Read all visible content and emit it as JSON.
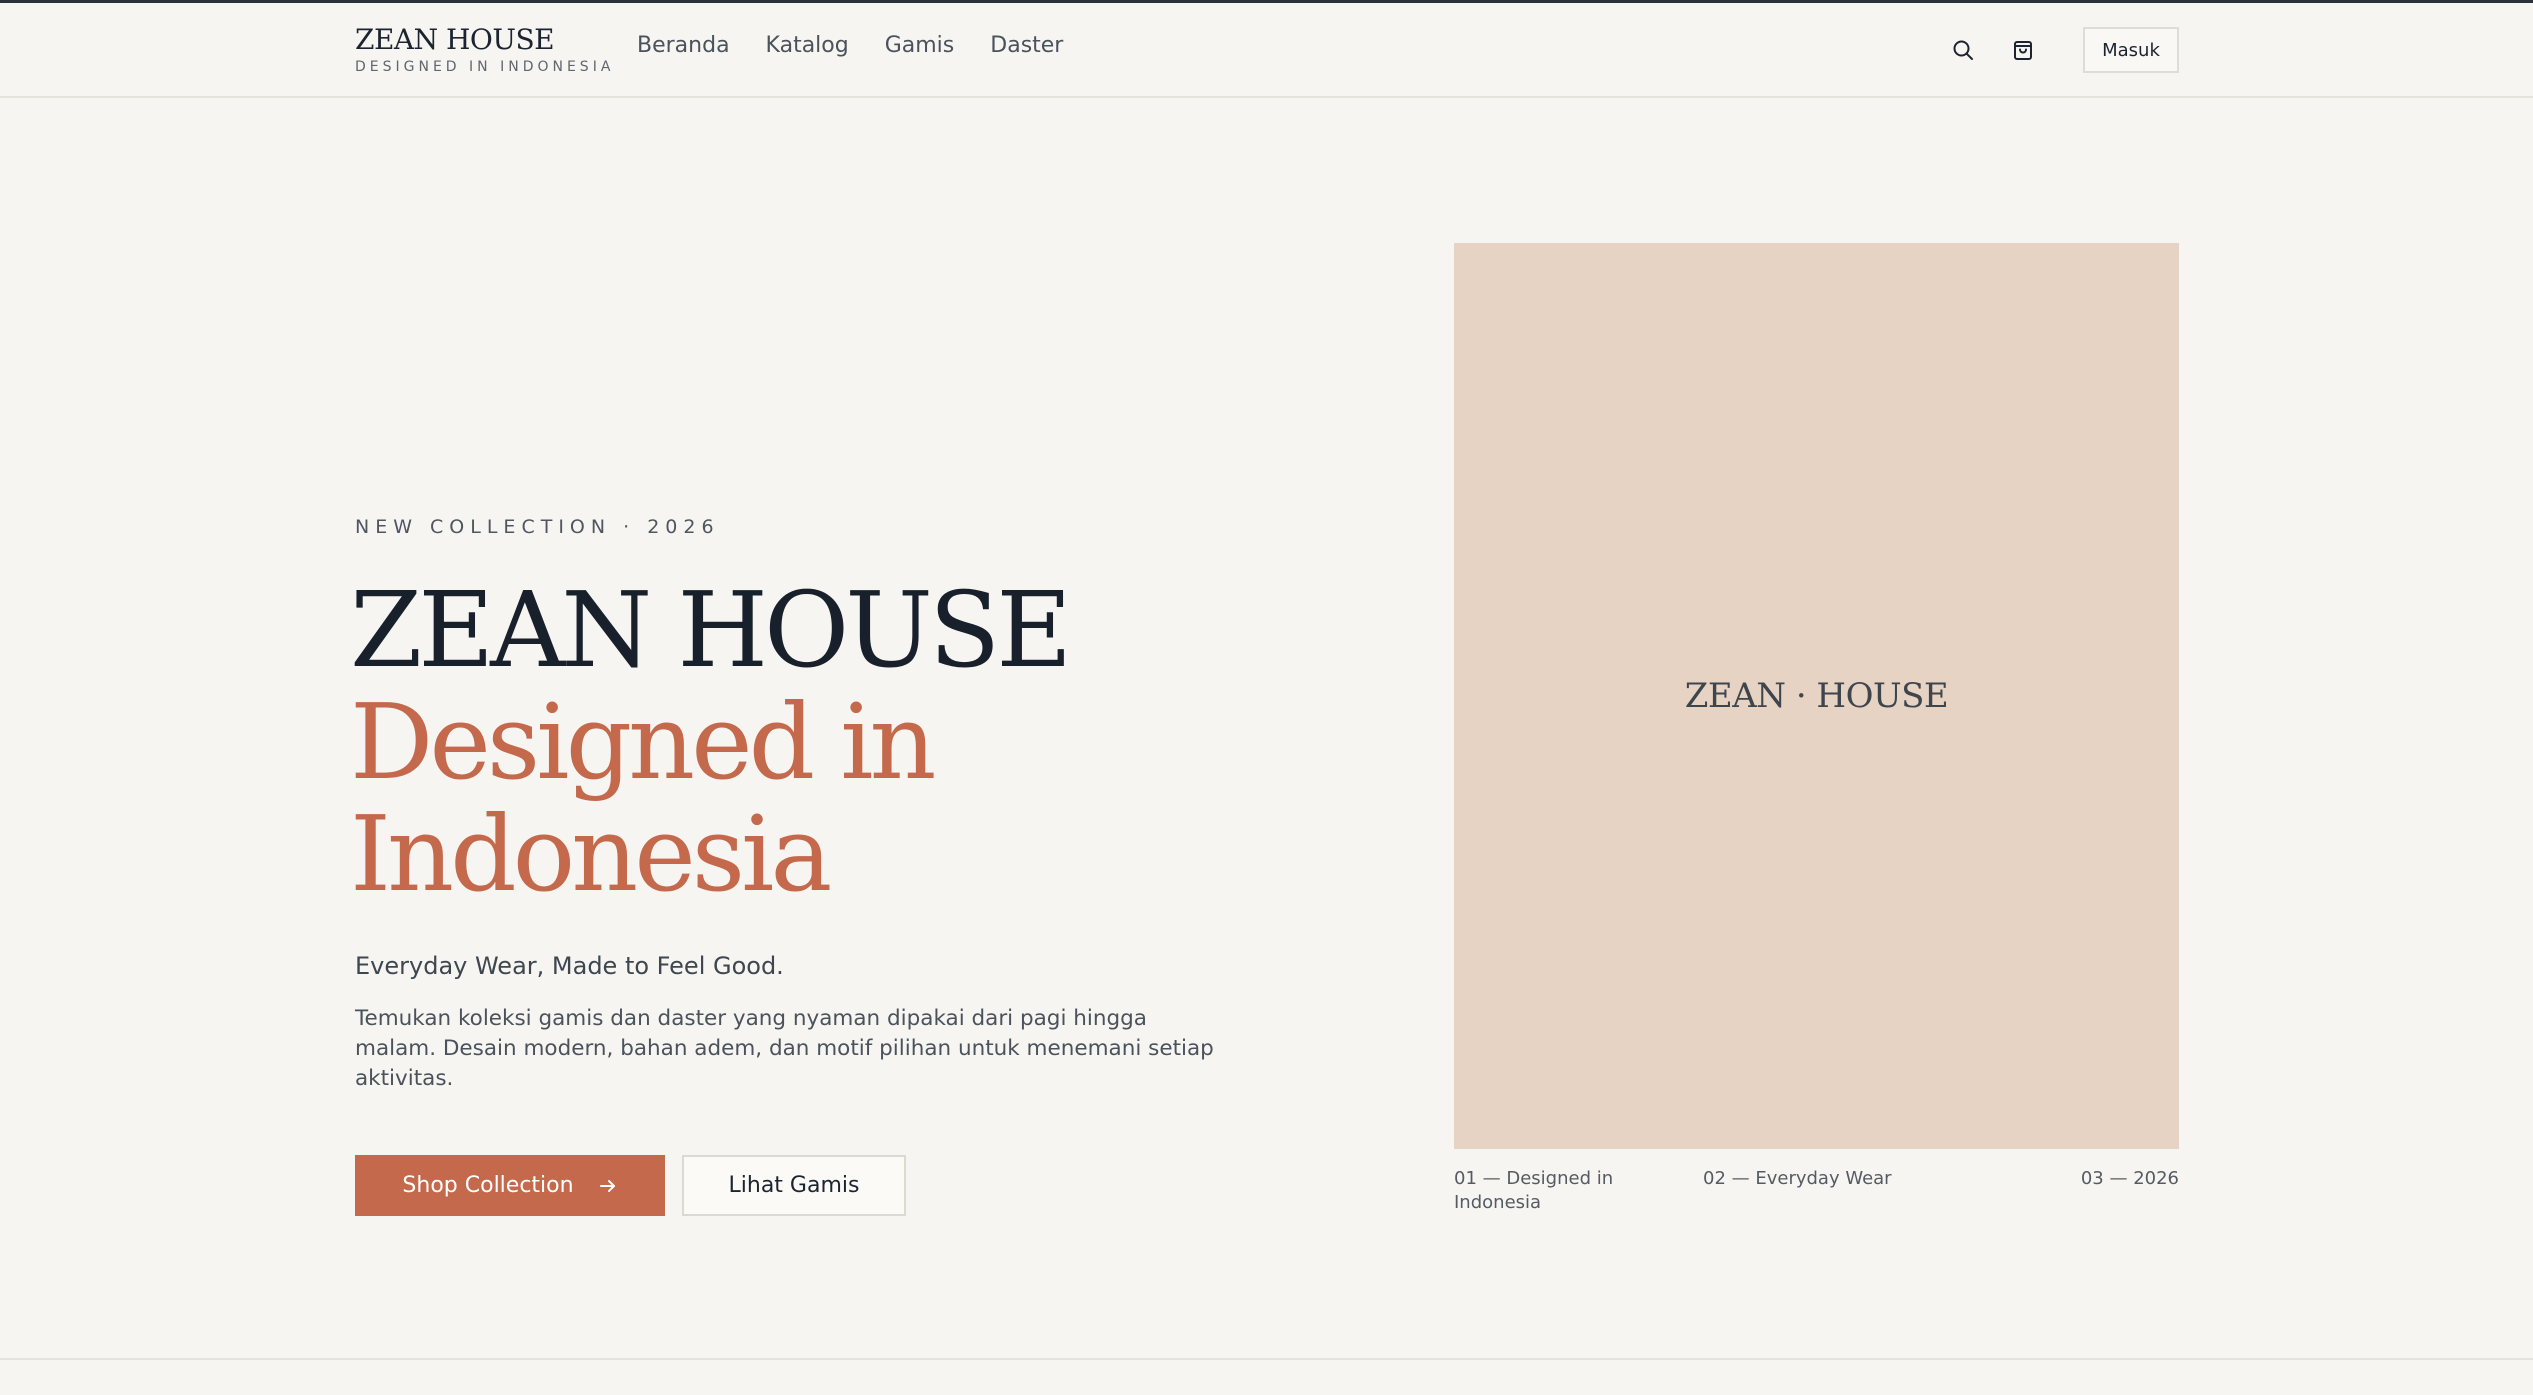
{
  "header": {
    "brand_name": "ZEAN HOUSE",
    "brand_tagline": "DESIGNED IN INDONESIA",
    "nav": [
      "Beranda",
      "Katalog",
      "Gamis",
      "Daster"
    ],
    "search_icon": "search-icon",
    "cart_icon": "shopping-bag-icon",
    "login_label": "Masuk"
  },
  "hero": {
    "eyebrow": "NEW COLLECTION · 2026",
    "title_line1": "ZEAN HOUSE",
    "title_line2": "Designed in",
    "title_line3": "Indonesia",
    "subtitle": "Everyday Wear, Made to Feel Good.",
    "description": "Temukan koleksi gamis dan daster yang nyaman dipakai dari pagi hingga malam. Desain modern, bahan adem, dan motif pilihan untuk menemani setiap aktivitas.",
    "primary_button": "Shop Collection",
    "primary_button_icon": "arrow-right-icon",
    "secondary_button": "Lihat Gamis"
  },
  "visual": {
    "label": "ZEAN · HOUSE",
    "captions": [
      "01 — Designed in Indonesia",
      "02 — Everyday Wear",
      "03 — 2026"
    ]
  },
  "colors": {
    "background": "#f7f5f1",
    "accent": "#c4694c",
    "text_dark": "#18202b",
    "visual_panel": "#e6d3c4"
  }
}
